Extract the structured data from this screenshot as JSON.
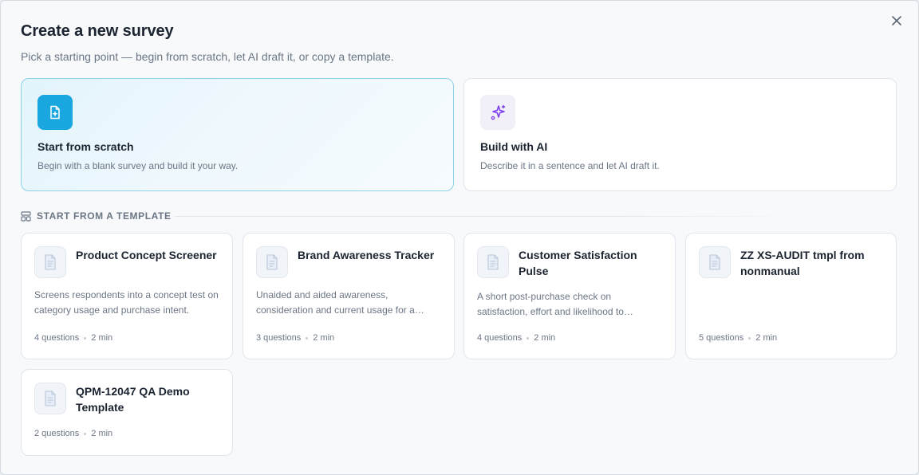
{
  "dialog": {
    "title": "Create a new survey",
    "subtitle": "Pick a starting point — begin from scratch, let AI draft it, or copy a template.",
    "close_icon": "close-icon"
  },
  "options": [
    {
      "title": "Start from scratch",
      "description": "Begin with a blank survey and build it your way.",
      "icon": "file-plus-icon",
      "selected": true,
      "accent": "#1aa6df"
    },
    {
      "title": "Build with AI",
      "description": "Describe it in a sentence and let AI draft it.",
      "icon": "sparkles-icon",
      "selected": false,
      "accent": "#7c3aed"
    }
  ],
  "templates_section": {
    "label": "START FROM A TEMPLATE",
    "icon": "template-layout-icon"
  },
  "templates": [
    {
      "title": "Product Concept Screener",
      "description": "Screens respondents into a concept test on category usage and purchase intent.",
      "questions": "4 questions",
      "duration": "2 min",
      "icon": "document-icon"
    },
    {
      "title": "Brand Awareness Tracker",
      "description": "Unaided and aided awareness, consideration and current usage for a category.",
      "questions": "3 questions",
      "duration": "2 min",
      "icon": "document-icon"
    },
    {
      "title": "Customer Satisfaction Pulse",
      "description": "A short post-purchase check on satisfaction, effort and likelihood to recommend.",
      "questions": "4 questions",
      "duration": "2 min",
      "icon": "document-icon"
    },
    {
      "title": "ZZ XS-AUDIT tmpl from nonmanual",
      "description": "",
      "questions": "5 questions",
      "duration": "2 min",
      "icon": "document-icon"
    },
    {
      "title": "QPM-12047 QA Demo Template",
      "description": "",
      "questions": "2 questions",
      "duration": "2 min",
      "icon": "document-icon"
    }
  ],
  "colors": {
    "accent_blue": "#1aa6df",
    "ai_purple": "#7c3aed",
    "selected_border": "#8ed2ea"
  }
}
